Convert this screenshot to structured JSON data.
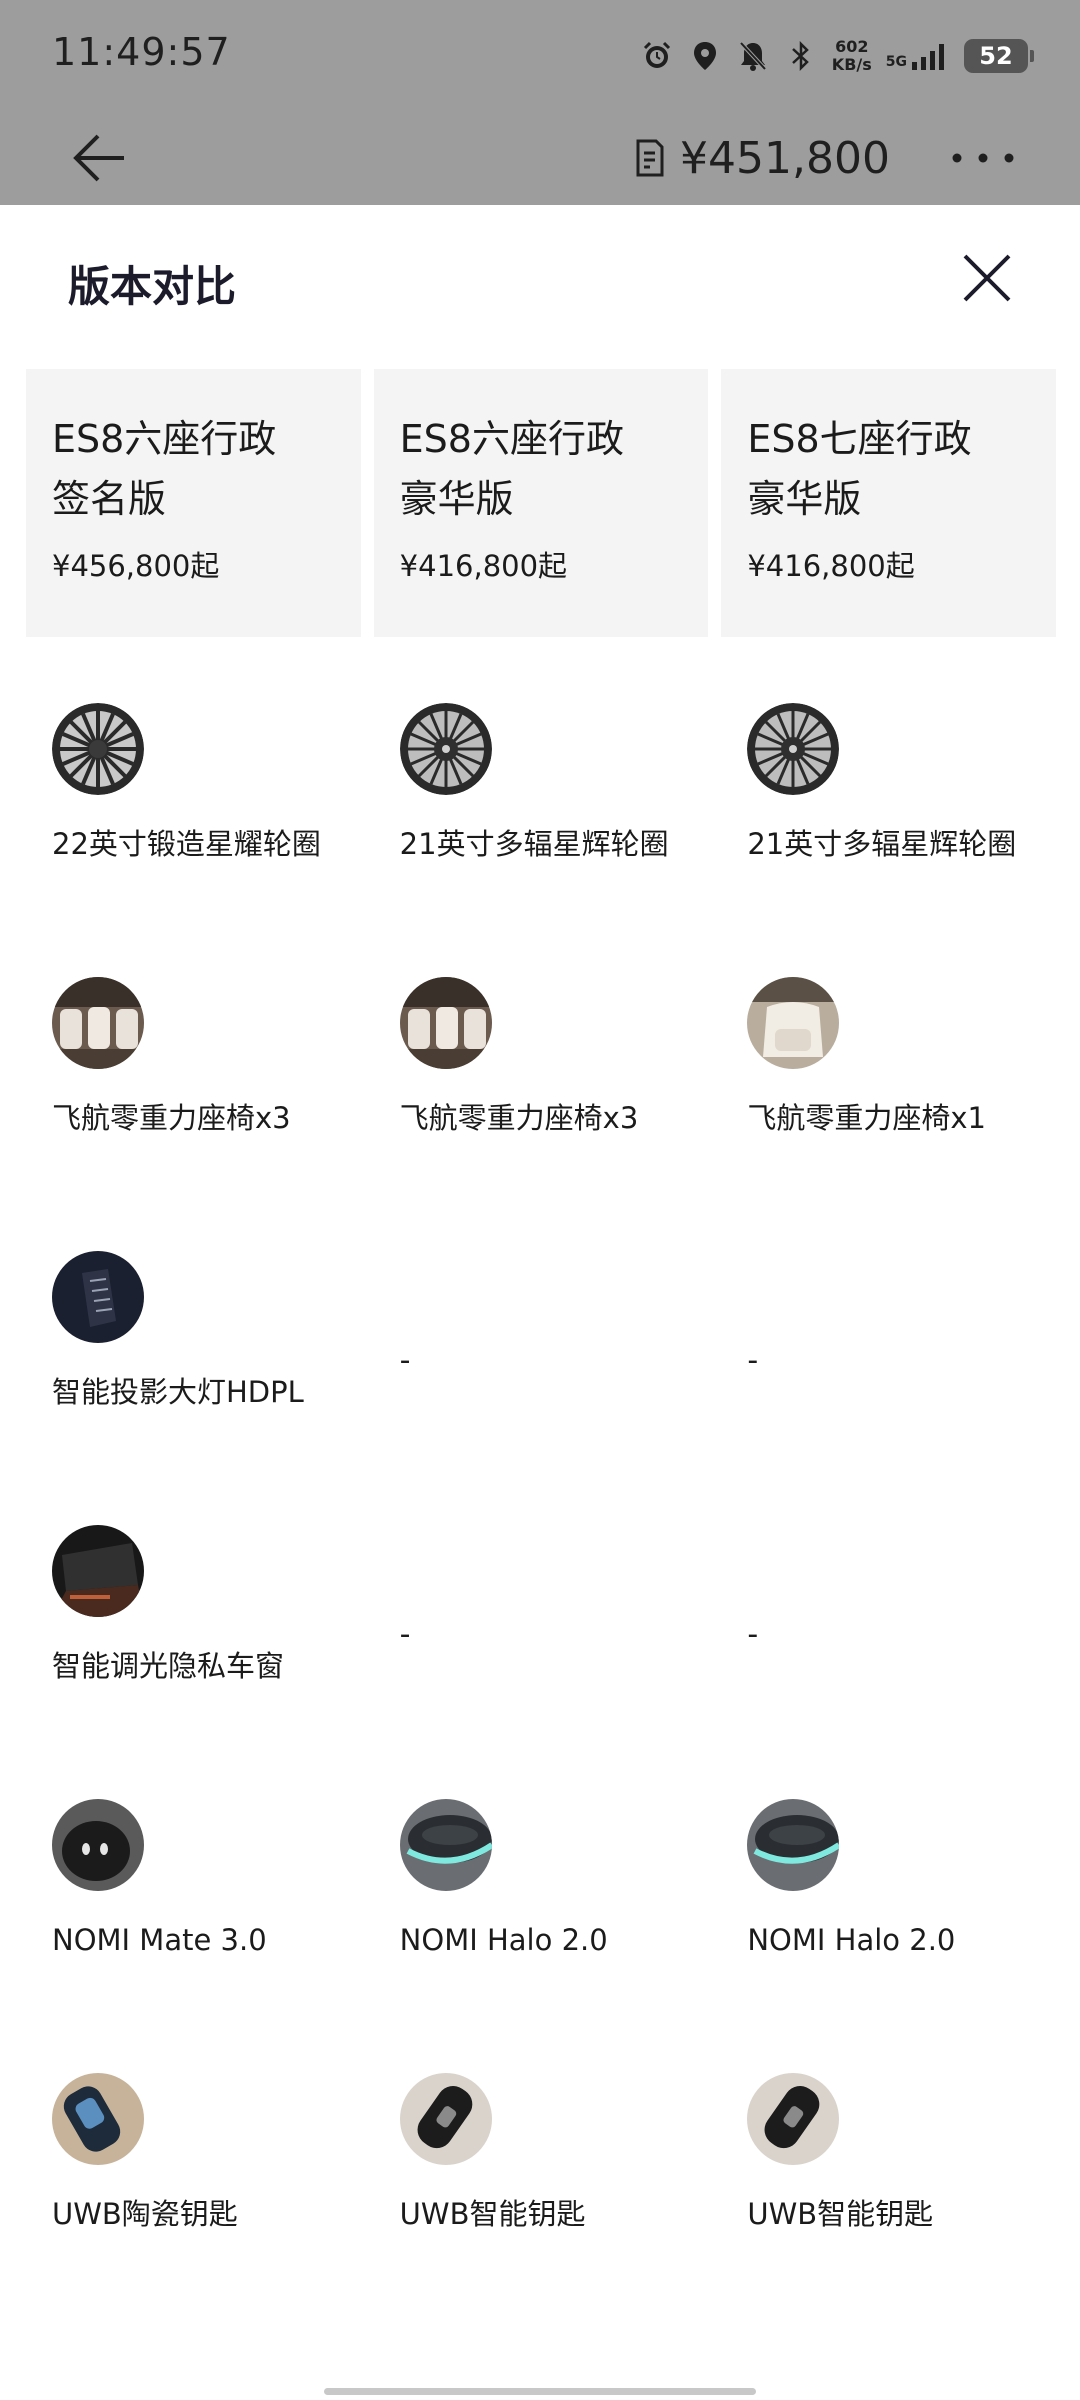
{
  "status_bar": {
    "time": "11:49:57",
    "net_speed_value": "602",
    "net_speed_unit": "KB/s",
    "network": "5G",
    "battery": "52",
    "icons": [
      "alarm-icon",
      "location-icon",
      "bell-off-icon",
      "bluetooth-icon",
      "signal-icon"
    ]
  },
  "app_bar": {
    "total_price": "¥451,800",
    "back_icon": "arrow-left-icon",
    "order_icon": "document-icon",
    "more_icon": "more-dots-icon"
  },
  "sheet": {
    "title": "版本对比",
    "close_icon": "close-icon",
    "versions": [
      {
        "name_line1": "ES8六座行政",
        "name_line2": "签名版",
        "price": "¥456,800起"
      },
      {
        "name_line1": "ES8六座行政",
        "name_line2": "豪华版",
        "price": "¥416,800起"
      },
      {
        "name_line1": "ES8七座行政",
        "name_line2": "豪华版",
        "price": "¥416,800起"
      }
    ],
    "feature_rows": [
      {
        "cells": [
          {
            "label": "22英寸锻造星耀轮圈",
            "icon": "wheel-image"
          },
          {
            "label": "21英寸多辐星辉轮圈",
            "icon": "wheel-image"
          },
          {
            "label": "21英寸多辐星辉轮圈",
            "icon": "wheel-image"
          }
        ]
      },
      {
        "cells": [
          {
            "label": "飞航零重力座椅x3",
            "icon": "seat-image"
          },
          {
            "label": "飞航零重力座椅x3",
            "icon": "seat-image"
          },
          {
            "label": "飞航零重力座椅x1",
            "icon": "seat-image"
          }
        ]
      },
      {
        "cells": [
          {
            "label": "智能投影大灯HDPL",
            "icon": "headlight-image"
          },
          {
            "label": "-"
          },
          {
            "label": "-"
          }
        ]
      },
      {
        "cells": [
          {
            "label": "智能调光隐私车窗",
            "icon": "window-image"
          },
          {
            "label": "-"
          },
          {
            "label": "-"
          }
        ]
      },
      {
        "cells": [
          {
            "label": "NOMI Mate 3.0",
            "icon": "nomi-mate-image"
          },
          {
            "label": "NOMI Halo 2.0",
            "icon": "nomi-halo-image"
          },
          {
            "label": "NOMI Halo 2.0",
            "icon": "nomi-halo-image"
          }
        ]
      },
      {
        "cells": [
          {
            "label": "UWB陶瓷钥匙",
            "icon": "ceramic-key-image"
          },
          {
            "label": "UWB智能钥匙",
            "icon": "smart-key-image"
          },
          {
            "label": "UWB智能钥匙",
            "icon": "smart-key-image"
          }
        ]
      }
    ]
  },
  "colors": {
    "backdrop": "#9d9d9d",
    "card_bg": "#f4f4f4",
    "title": "#1b1b2b"
  }
}
